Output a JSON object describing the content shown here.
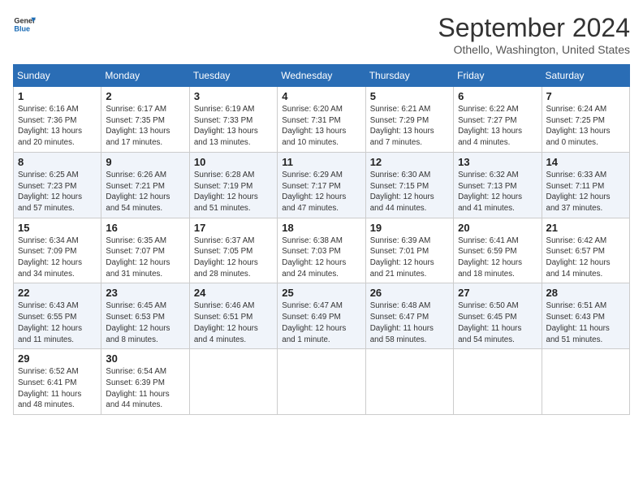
{
  "header": {
    "logo_line1": "General",
    "logo_line2": "Blue",
    "month": "September 2024",
    "location": "Othello, Washington, United States"
  },
  "days_of_week": [
    "Sunday",
    "Monday",
    "Tuesday",
    "Wednesday",
    "Thursday",
    "Friday",
    "Saturday"
  ],
  "weeks": [
    [
      {
        "day": "1",
        "info": "Sunrise: 6:16 AM\nSunset: 7:36 PM\nDaylight: 13 hours\nand 20 minutes."
      },
      {
        "day": "2",
        "info": "Sunrise: 6:17 AM\nSunset: 7:35 PM\nDaylight: 13 hours\nand 17 minutes."
      },
      {
        "day": "3",
        "info": "Sunrise: 6:19 AM\nSunset: 7:33 PM\nDaylight: 13 hours\nand 13 minutes."
      },
      {
        "day": "4",
        "info": "Sunrise: 6:20 AM\nSunset: 7:31 PM\nDaylight: 13 hours\nand 10 minutes."
      },
      {
        "day": "5",
        "info": "Sunrise: 6:21 AM\nSunset: 7:29 PM\nDaylight: 13 hours\nand 7 minutes."
      },
      {
        "day": "6",
        "info": "Sunrise: 6:22 AM\nSunset: 7:27 PM\nDaylight: 13 hours\nand 4 minutes."
      },
      {
        "day": "7",
        "info": "Sunrise: 6:24 AM\nSunset: 7:25 PM\nDaylight: 13 hours\nand 0 minutes."
      }
    ],
    [
      {
        "day": "8",
        "info": "Sunrise: 6:25 AM\nSunset: 7:23 PM\nDaylight: 12 hours\nand 57 minutes."
      },
      {
        "day": "9",
        "info": "Sunrise: 6:26 AM\nSunset: 7:21 PM\nDaylight: 12 hours\nand 54 minutes."
      },
      {
        "day": "10",
        "info": "Sunrise: 6:28 AM\nSunset: 7:19 PM\nDaylight: 12 hours\nand 51 minutes."
      },
      {
        "day": "11",
        "info": "Sunrise: 6:29 AM\nSunset: 7:17 PM\nDaylight: 12 hours\nand 47 minutes."
      },
      {
        "day": "12",
        "info": "Sunrise: 6:30 AM\nSunset: 7:15 PM\nDaylight: 12 hours\nand 44 minutes."
      },
      {
        "day": "13",
        "info": "Sunrise: 6:32 AM\nSunset: 7:13 PM\nDaylight: 12 hours\nand 41 minutes."
      },
      {
        "day": "14",
        "info": "Sunrise: 6:33 AM\nSunset: 7:11 PM\nDaylight: 12 hours\nand 37 minutes."
      }
    ],
    [
      {
        "day": "15",
        "info": "Sunrise: 6:34 AM\nSunset: 7:09 PM\nDaylight: 12 hours\nand 34 minutes."
      },
      {
        "day": "16",
        "info": "Sunrise: 6:35 AM\nSunset: 7:07 PM\nDaylight: 12 hours\nand 31 minutes."
      },
      {
        "day": "17",
        "info": "Sunrise: 6:37 AM\nSunset: 7:05 PM\nDaylight: 12 hours\nand 28 minutes."
      },
      {
        "day": "18",
        "info": "Sunrise: 6:38 AM\nSunset: 7:03 PM\nDaylight: 12 hours\nand 24 minutes."
      },
      {
        "day": "19",
        "info": "Sunrise: 6:39 AM\nSunset: 7:01 PM\nDaylight: 12 hours\nand 21 minutes."
      },
      {
        "day": "20",
        "info": "Sunrise: 6:41 AM\nSunset: 6:59 PM\nDaylight: 12 hours\nand 18 minutes."
      },
      {
        "day": "21",
        "info": "Sunrise: 6:42 AM\nSunset: 6:57 PM\nDaylight: 12 hours\nand 14 minutes."
      }
    ],
    [
      {
        "day": "22",
        "info": "Sunrise: 6:43 AM\nSunset: 6:55 PM\nDaylight: 12 hours\nand 11 minutes."
      },
      {
        "day": "23",
        "info": "Sunrise: 6:45 AM\nSunset: 6:53 PM\nDaylight: 12 hours\nand 8 minutes."
      },
      {
        "day": "24",
        "info": "Sunrise: 6:46 AM\nSunset: 6:51 PM\nDaylight: 12 hours\nand 4 minutes."
      },
      {
        "day": "25",
        "info": "Sunrise: 6:47 AM\nSunset: 6:49 PM\nDaylight: 12 hours\nand 1 minute."
      },
      {
        "day": "26",
        "info": "Sunrise: 6:48 AM\nSunset: 6:47 PM\nDaylight: 11 hours\nand 58 minutes."
      },
      {
        "day": "27",
        "info": "Sunrise: 6:50 AM\nSunset: 6:45 PM\nDaylight: 11 hours\nand 54 minutes."
      },
      {
        "day": "28",
        "info": "Sunrise: 6:51 AM\nSunset: 6:43 PM\nDaylight: 11 hours\nand 51 minutes."
      }
    ],
    [
      {
        "day": "29",
        "info": "Sunrise: 6:52 AM\nSunset: 6:41 PM\nDaylight: 11 hours\nand 48 minutes."
      },
      {
        "day": "30",
        "info": "Sunrise: 6:54 AM\nSunset: 6:39 PM\nDaylight: 11 hours\nand 44 minutes."
      },
      {
        "day": "",
        "info": ""
      },
      {
        "day": "",
        "info": ""
      },
      {
        "day": "",
        "info": ""
      },
      {
        "day": "",
        "info": ""
      },
      {
        "day": "",
        "info": ""
      }
    ]
  ]
}
